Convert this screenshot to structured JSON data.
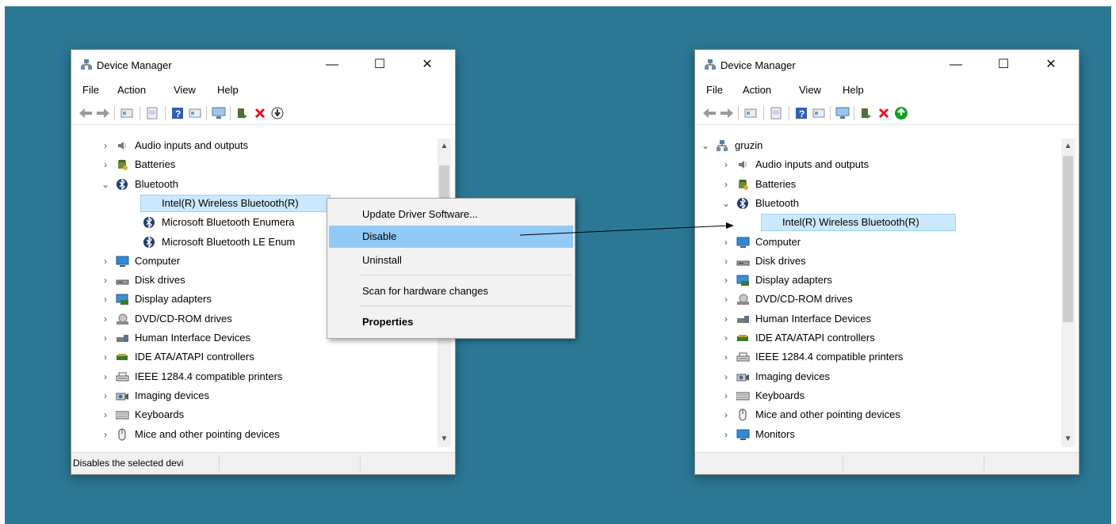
{
  "left_window": {
    "title": "Device Manager",
    "controls": {
      "minimize": "—",
      "maximize": "☐",
      "close": "✕"
    },
    "menu": [
      "File",
      "Action",
      "View",
      "Help"
    ],
    "tree": [
      {
        "label": "Audio inputs and outputs",
        "icon": "speaker-icon",
        "expanded": false
      },
      {
        "label": "Batteries",
        "icon": "battery-icon",
        "expanded": false
      },
      {
        "label": "Bluetooth",
        "icon": "bluetooth-icon",
        "expanded": true
      },
      {
        "label": "Intel(R) Wireless Bluetooth(R)",
        "icon": "bluetooth-icon",
        "child": true,
        "selected": true
      },
      {
        "label": "Microsoft Bluetooth Enumera",
        "icon": "bluetooth-icon",
        "child": true
      },
      {
        "label": "Microsoft Bluetooth LE Enum",
        "icon": "bluetooth-icon",
        "child": true
      },
      {
        "label": "Computer",
        "icon": "monitor-icon",
        "expanded": false
      },
      {
        "label": "Disk drives",
        "icon": "disk-icon",
        "expanded": false
      },
      {
        "label": "Display adapters",
        "icon": "display-adapter-icon",
        "expanded": false
      },
      {
        "label": "DVD/CD-ROM drives",
        "icon": "dvd-icon",
        "expanded": false
      },
      {
        "label": "Human Interface Devices",
        "icon": "hid-icon",
        "expanded": false
      },
      {
        "label": "IDE ATA/ATAPI controllers",
        "icon": "ide-icon",
        "expanded": false
      },
      {
        "label": "IEEE 1284.4 compatible printers",
        "icon": "printer-icon",
        "expanded": false
      },
      {
        "label": "Imaging devices",
        "icon": "camera-icon",
        "expanded": false
      },
      {
        "label": "Keyboards",
        "icon": "keyboard-icon",
        "expanded": false
      },
      {
        "label": "Mice and other pointing devices",
        "icon": "mouse-icon",
        "expanded": false
      }
    ],
    "status": "Disables the selected devi"
  },
  "context_menu": {
    "items": [
      "Update Driver Software...",
      "Disable",
      "Uninstall",
      "Scan for hardware changes",
      "Properties"
    ],
    "highlighted": "Disable"
  },
  "right_window": {
    "title": "Device Manager",
    "controls": {
      "minimize": "—",
      "maximize": "☐",
      "close": "✕"
    },
    "menu": [
      "File",
      "Action",
      "View",
      "Help"
    ],
    "tree": [
      {
        "label": "gruzin",
        "icon": "computer-root-icon",
        "expanded": true,
        "root": true
      },
      {
        "label": "Audio inputs and outputs",
        "icon": "speaker-icon",
        "expanded": false
      },
      {
        "label": "Batteries",
        "icon": "battery-icon",
        "expanded": false
      },
      {
        "label": "Bluetooth",
        "icon": "bluetooth-icon",
        "expanded": true
      },
      {
        "label": "Intel(R) Wireless Bluetooth(R)",
        "icon": "bluetooth-disabled-icon",
        "child": true,
        "selected": true
      },
      {
        "label": "Computer",
        "icon": "monitor-icon",
        "expanded": false
      },
      {
        "label": "Disk drives",
        "icon": "disk-icon",
        "expanded": false
      },
      {
        "label": "Display adapters",
        "icon": "display-adapter-icon",
        "expanded": false
      },
      {
        "label": "DVD/CD-ROM drives",
        "icon": "dvd-icon",
        "expanded": false
      },
      {
        "label": "Human Interface Devices",
        "icon": "hid-icon",
        "expanded": false
      },
      {
        "label": "IDE ATA/ATAPI controllers",
        "icon": "ide-icon",
        "expanded": false
      },
      {
        "label": "IEEE 1284.4 compatible printers",
        "icon": "printer-icon",
        "expanded": false
      },
      {
        "label": "Imaging devices",
        "icon": "camera-icon",
        "expanded": false
      },
      {
        "label": "Keyboards",
        "icon": "keyboard-icon",
        "expanded": false
      },
      {
        "label": "Mice and other pointing devices",
        "icon": "mouse-icon",
        "expanded": false
      },
      {
        "label": "Monitors",
        "icon": "monitor-icon",
        "expanded": false
      }
    ],
    "status": ""
  },
  "colors": {
    "background": "#2b7895",
    "menu_highlight": "#91c9f7",
    "selection": "#cce8ff",
    "disable_icon_red": "#e81123",
    "enable_icon_green": "#10a020"
  }
}
